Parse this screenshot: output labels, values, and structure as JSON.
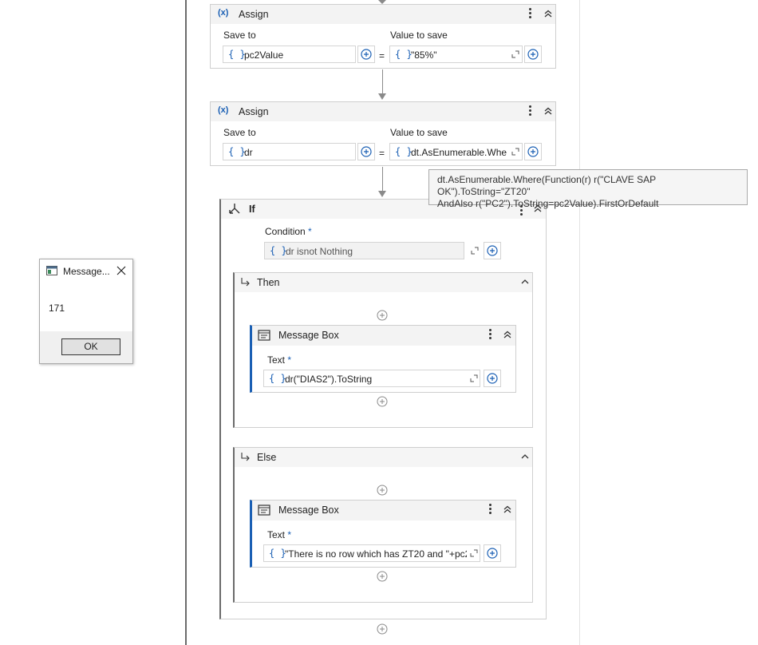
{
  "assign1": {
    "title": "Assign",
    "save_to_label": "Save to",
    "value_label": "Value to save",
    "save_to_value": "pc2Value",
    "value": "\"85%\"",
    "equals": "="
  },
  "assign2": {
    "title": "Assign",
    "save_to_label": "Save to",
    "value_label": "Value to save",
    "save_to_value": "dr",
    "value": "dt.AsEnumerable.Whe",
    "equals": "="
  },
  "tooltip": {
    "line1": "dt.AsEnumerable.Where(Function(r) r(\"CLAVE SAP OK\").ToString=\"ZT20\"",
    "line2": "AndAlso r(\"PC2\").ToString=pc2Value).FirstOrDefault"
  },
  "if_block": {
    "title": "If",
    "condition_label": "Condition",
    "required_mark": "*",
    "condition_value": "dr isnot Nothing",
    "then_label": "Then",
    "else_label": "Else"
  },
  "then_msg": {
    "title": "Message Box",
    "text_label": "Text",
    "required_mark": "*",
    "text_value": "dr(\"DIAS2\").ToString"
  },
  "else_msg": {
    "title": "Message Box",
    "text_label": "Text",
    "required_mark": "*",
    "text_value": "\"There is no row which has ZT20 and \"+pc2"
  },
  "dialog": {
    "title": "Message...",
    "message": "171",
    "ok_label": "OK"
  },
  "colors": {
    "accent": "#1a5fb4",
    "header_bg": "#f3f3f3",
    "border": "#cfcfcf"
  }
}
